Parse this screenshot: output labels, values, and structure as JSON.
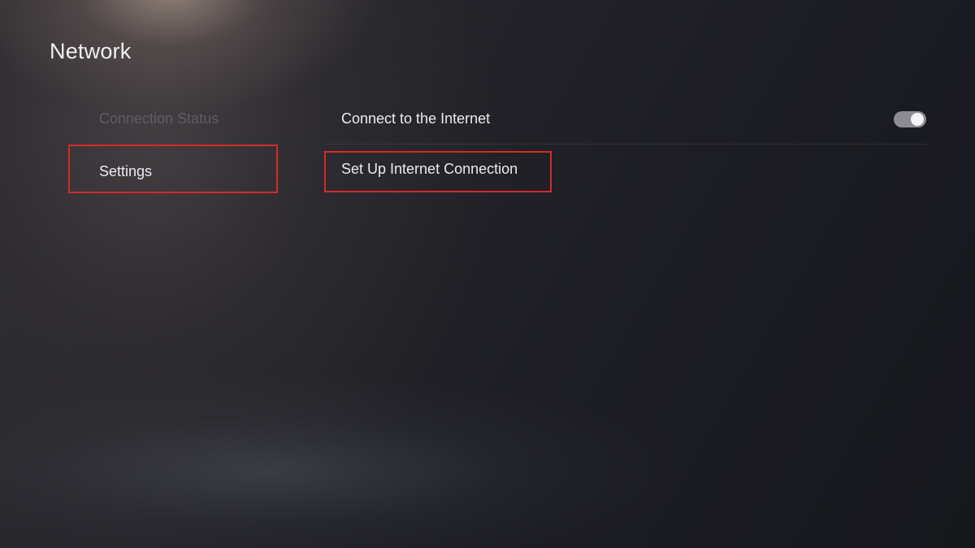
{
  "page": {
    "title": "Network"
  },
  "sidebar": {
    "items": [
      {
        "label": "Connection Status",
        "state": "disabled"
      },
      {
        "label": "Settings",
        "state": "selected"
      }
    ]
  },
  "main": {
    "options": [
      {
        "label": "Connect to the Internet",
        "toggle": {
          "on": true
        }
      },
      {
        "label": "Set Up Internet Connection"
      }
    ]
  },
  "colors": {
    "highlight_border": "#d42a2a",
    "disabled_text": "#5d5e66",
    "primary_text": "#ececef",
    "toggle_track": "#8c8c94"
  }
}
